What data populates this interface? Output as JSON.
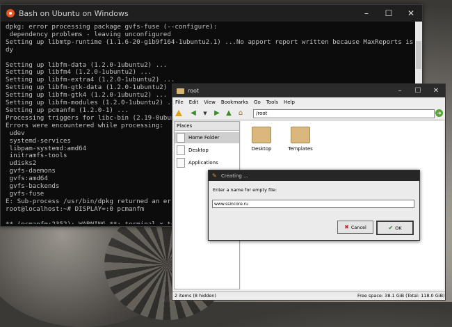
{
  "terminal": {
    "title": "Bash on Ubuntu on Windows",
    "controls": {
      "minimize": "–",
      "maximize": "☐",
      "close": "✕"
    },
    "lines": [
      "dpkg: error processing package gvfs-fuse (--configure):",
      " dependency problems - leaving unconfigured",
      "Setting up libmtp-runtime (1.1.6-20-g1b9f164-1ubuntu2.1) ...No apport report written because MaxReports is reached alrea",
      "dy",
      "",
      "Setting up libfm-data (1.2.0-1ubuntu2) ...",
      "Setting up libfm4 (1.2.0-1ubuntu2) ...",
      "Setting up libfm-extra4 (1.2.0-1ubuntu2) ...",
      "Setting up libfm-gtk-data (1.2.0-1ubuntu2) ...",
      "Setting up libfm-gtk4 (1.2.0-1ubuntu2) ...",
      "Setting up libfm-modules (1.2.0-1ubuntu2) ...",
      "Setting up pcmanfm (1.2.0-1) ...",
      "Processing triggers for libc-bin (2.19-0ubuntu6.7",
      "Errors were encountered while processing:",
      " udev",
      " systemd-services",
      " libpam-systemd:amd64",
      " initramfs-tools",
      " udisks2",
      " gvfs-daemons",
      " gvfs:amd64",
      " gvfs-backends",
      " gvfs-fuse",
      "E: Sub-process /usr/bin/dpkg returned an error co",
      "root@localhost:~# DISPLAY=:0 pcmanfm",
      "",
      "** (pcmanfm:2352): WARNING **: terminal x-termina",
      "",
      "** (pcmanfm:2352): WARNING **: modules directory"
    ]
  },
  "file_manager": {
    "title": "root",
    "controls": {
      "minimize": "–",
      "maximize": "☐",
      "close": "✕"
    },
    "menu": [
      "File",
      "Edit",
      "View",
      "Bookmarks",
      "Go",
      "Tools",
      "Help"
    ],
    "address": "/root",
    "places": {
      "header": "Places",
      "items": [
        "Home Folder",
        "Desktop",
        "Applications"
      ]
    },
    "folders": [
      "Desktop",
      "Templates"
    ],
    "status_left": "2 items (8 hidden)",
    "status_right": "Free space: 38.1 GiB (Total: 118.0 GiB)"
  },
  "dialog": {
    "title": "Creating ...",
    "prompt": "Enter a name for empty file:",
    "value": "www.ssincore.ru",
    "cancel_label": "Cancel",
    "ok_label": "OK"
  },
  "colors": {
    "ubuntu_orange": "#e95420",
    "folder": "#d9b77d",
    "go_green": "#5aa33a"
  }
}
